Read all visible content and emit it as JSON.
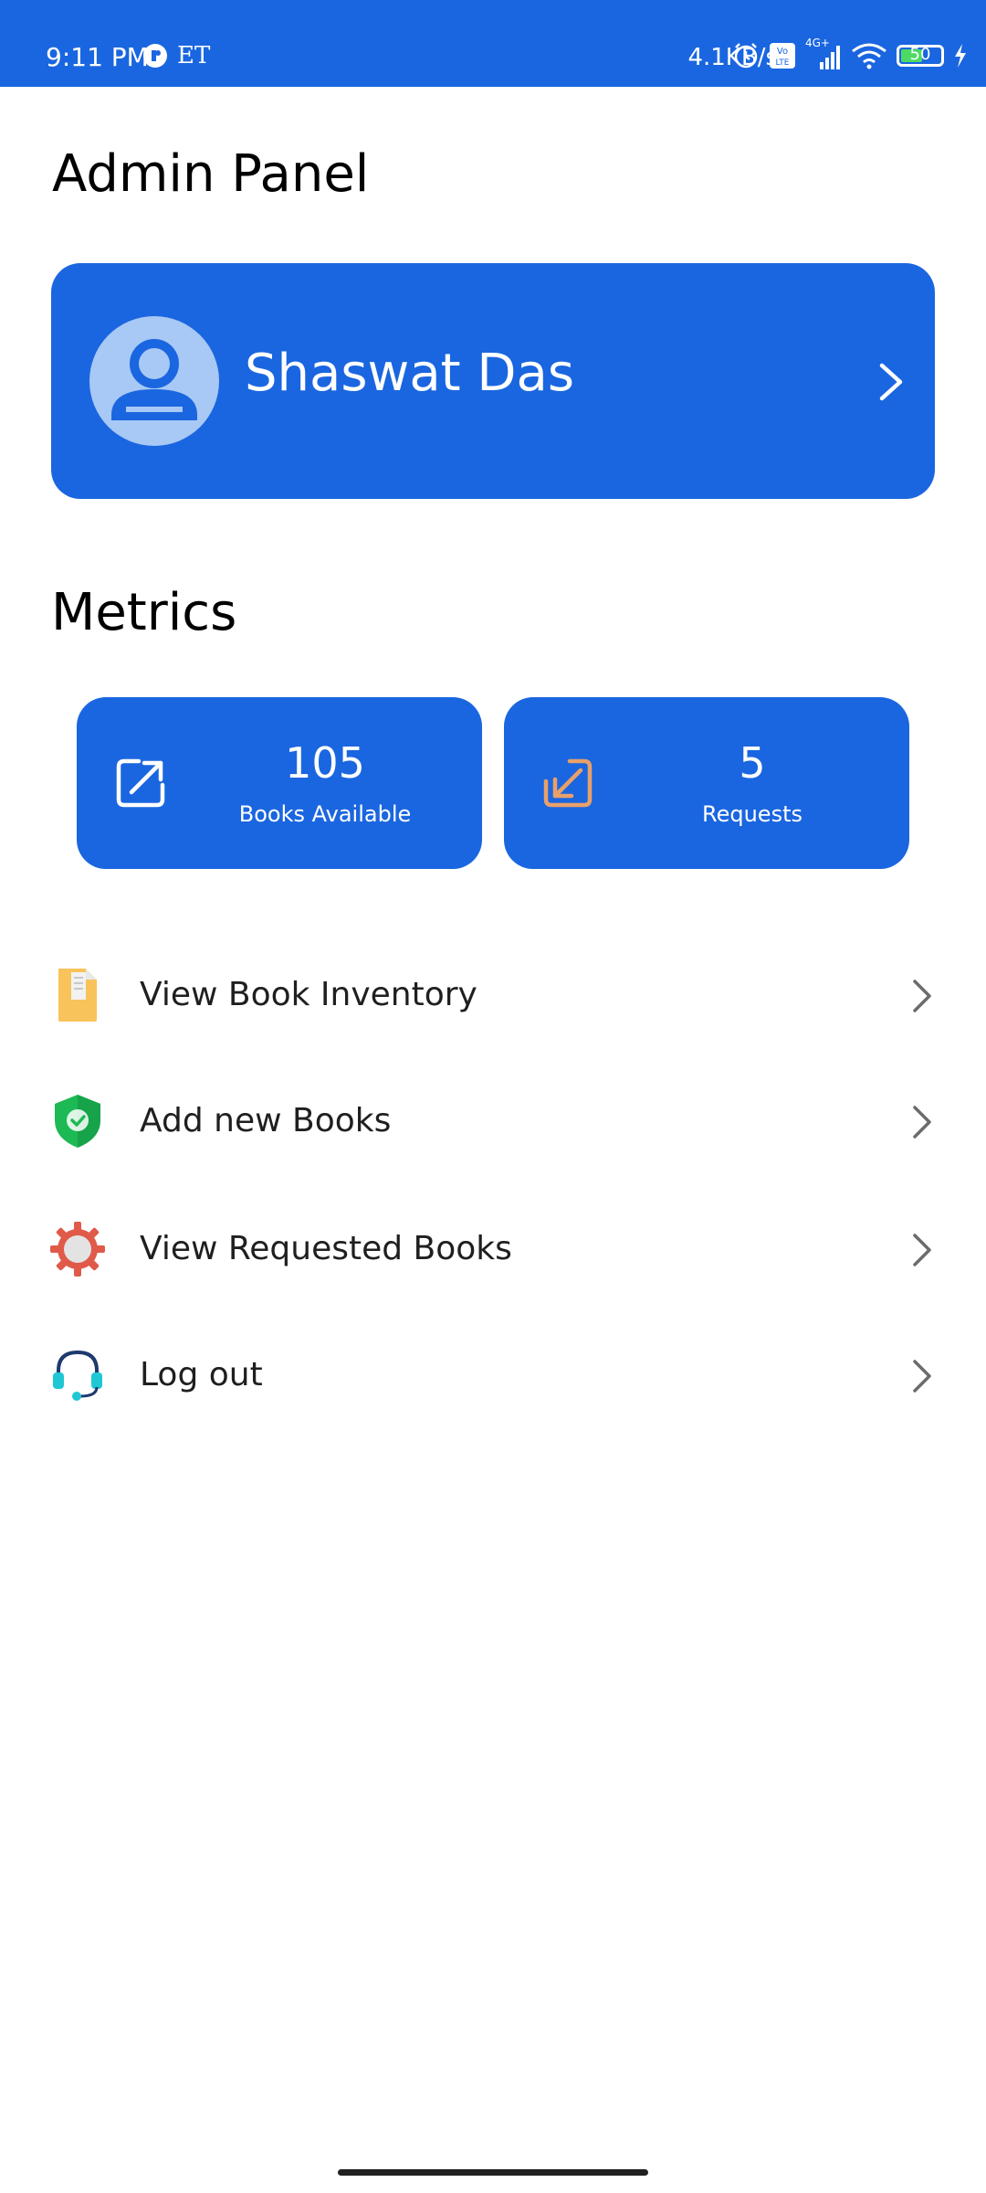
{
  "status_bar": {
    "time": "9:11 PM",
    "left_icons": [
      "notification-app-icon",
      "et-icon"
    ],
    "et_label": "ET",
    "network_speed": "4.1KB/s",
    "right_icons": [
      "alarm-icon",
      "volte-icon",
      "signal-icon",
      "wifi-icon",
      "battery-icon",
      "charging-icon"
    ],
    "battery_level": "50",
    "network_type": "4G+"
  },
  "page": {
    "title": "Admin Panel"
  },
  "profile": {
    "name": "Shaswat Das",
    "avatar_icon": "user-avatar-icon"
  },
  "metrics": {
    "title": "Metrics",
    "cards": [
      {
        "value": "105",
        "label": "Books Available",
        "icon": "outgoing-arrow-icon"
      },
      {
        "value": "5",
        "label": "Requests",
        "icon": "incoming-arrow-icon"
      }
    ]
  },
  "menu": {
    "items": [
      {
        "label": "View Book Inventory",
        "icon": "document-icon"
      },
      {
        "label": "Add new Books",
        "icon": "shield-check-icon"
      },
      {
        "label": "View Requested Books",
        "icon": "gear-icon"
      },
      {
        "label": "Log out",
        "icon": "headset-icon"
      }
    ]
  },
  "colors": {
    "primary": "#1A66E0",
    "avatar_bg": "#A8C8F5",
    "incoming_arrow": "#E8A06A",
    "document": "#F7C35A",
    "shield": "#1DB954",
    "gear": "#E05A4A",
    "headset": "#1FC7D4"
  }
}
